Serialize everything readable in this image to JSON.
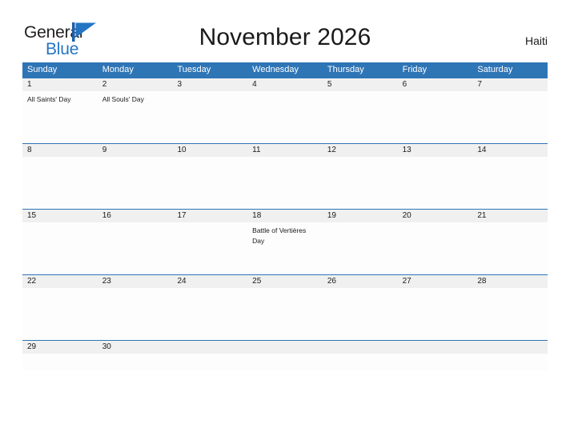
{
  "brand": {
    "name_line1": "General",
    "name_line2": "Blue",
    "flag_icon": "blue-flag-triangle"
  },
  "header": {
    "title": "November 2026",
    "region": "Haiti"
  },
  "colors": {
    "header_blue": "#2e75b6",
    "date_row_gray": "#f0f0f0",
    "brand_blue": "#2575c4",
    "text_dark": "#1a1a1a"
  },
  "calendar": {
    "weekdays": [
      "Sunday",
      "Monday",
      "Tuesday",
      "Wednesday",
      "Thursday",
      "Friday",
      "Saturday"
    ],
    "weeks": [
      {
        "dates": [
          "1",
          "2",
          "3",
          "4",
          "5",
          "6",
          "7"
        ],
        "events": [
          "All Saints' Day",
          "All Souls' Day",
          "",
          "",
          "",
          "",
          ""
        ]
      },
      {
        "dates": [
          "8",
          "9",
          "10",
          "11",
          "12",
          "13",
          "14"
        ],
        "events": [
          "",
          "",
          "",
          "",
          "",
          "",
          ""
        ]
      },
      {
        "dates": [
          "15",
          "16",
          "17",
          "18",
          "19",
          "20",
          "21"
        ],
        "events": [
          "",
          "",
          "",
          "Battle of Vertières Day",
          "",
          "",
          ""
        ]
      },
      {
        "dates": [
          "22",
          "23",
          "24",
          "25",
          "26",
          "27",
          "28"
        ],
        "events": [
          "",
          "",
          "",
          "",
          "",
          "",
          ""
        ]
      },
      {
        "dates": [
          "29",
          "30",
          "",
          "",
          "",
          "",
          ""
        ],
        "events": [
          "",
          "",
          "",
          "",
          "",
          "",
          ""
        ]
      }
    ]
  }
}
